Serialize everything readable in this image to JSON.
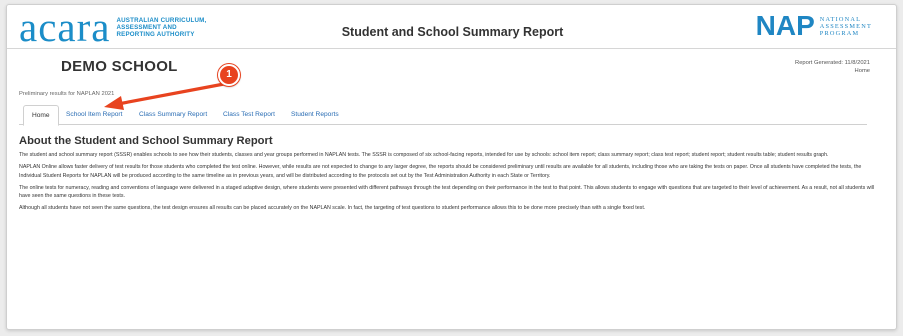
{
  "header": {
    "acara_logo_word": "acara",
    "acara_logo_tagline": [
      "Australian Curriculum,",
      "Assessment and",
      "Reporting Authority"
    ],
    "title": "Student and School Summary Report",
    "nap_logo_word": "NAP",
    "nap_logo_tagline": [
      "National",
      "Assessment",
      "Program"
    ]
  },
  "school": {
    "name": "DEMO SCHOOL",
    "report_generated": "Report Generated: 11/8/2021",
    "breadcrumb": "Home",
    "preliminary_note": "Preliminary results for NAPLAN 2021"
  },
  "tabs": [
    {
      "label": "Home",
      "active": true
    },
    {
      "label": "School Item Report",
      "active": false
    },
    {
      "label": "Class Summary Report",
      "active": false
    },
    {
      "label": "Class Test Report",
      "active": false
    },
    {
      "label": "Student Reports",
      "active": false
    }
  ],
  "main": {
    "title": "About the Student and School Summary Report",
    "paragraphs": [
      "The student and school summary report (SSSR) enables schools to see how their students, classes and year groups performed in NAPLAN tests. The SSSR is composed of six school-facing reports, intended for use by schools: school item report; class summary report; class test report; student report; student results table; student results graph.",
      "NAPLAN Online allows faster delivery of test results for those students who completed the test online. However, while results are not expected to change to any larger degree, the reports should be considered preliminary until results are available for all students, including those who are taking the tests on paper. Once all students have completed the tests, the Individual Student Reports for NAPLAN will be produced according to the same timeline as in previous years, and will be distributed according to the protocols set out by the Test Administration Authority in each State or Territory.",
      "The online tests for numeracy, reading and conventions of language were delivered in a staged adaptive design, where students were presented with different pathways through the test depending on their performance in the test to that point. This allows students to engage with questions that are targeted to their level of achievement. As a result, not all students will have seen the same questions in these tests.",
      "Although all students have not seen the same questions, the test design ensures all results can be placed accurately on the NAPLAN scale. In fact, the targeting of test questions to student performance allows this to be done more precisely than with a single fixed test."
    ]
  },
  "annotation": {
    "step_number": "1"
  },
  "colors": {
    "brand_blue": "#1b8dc8",
    "link_blue": "#2a6db4",
    "annotation_red": "#e8431f"
  }
}
